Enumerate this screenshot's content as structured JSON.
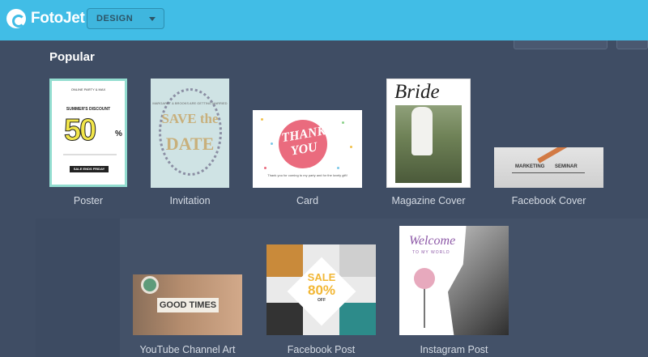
{
  "app": {
    "name": "FotoJet",
    "mode_select": "DESIGN"
  },
  "section": {
    "title": "Popular"
  },
  "templates": [
    {
      "label": "Poster"
    },
    {
      "label": "Invitation"
    },
    {
      "label": "Card"
    },
    {
      "label": "Magazine Cover"
    },
    {
      "label": "Facebook Cover"
    },
    {
      "label": "YouTube Channel Art"
    },
    {
      "label": "Facebook Post"
    },
    {
      "label": "Instagram Post"
    }
  ],
  "thumbs": {
    "poster": {
      "top": "ONLINE PARTY & MAX",
      "head": "SUMMER'S DISCOUNT",
      "big": "50",
      "pct": "%",
      "sale": "SALE ENDS FRIDAY"
    },
    "invitation": {
      "names": "MARGARET & BROOKS ARE GETTING MARRIED",
      "save": "SAVE the",
      "date": "DATE"
    },
    "card": {
      "thanks": "THANK YOU",
      "msg": "Thank you for coming to my party and for the lovely gift!"
    },
    "magazine": {
      "title": "Bride"
    },
    "fbcover": {
      "left": "MARKETING",
      "right": "SEMINAR"
    },
    "youtube": {
      "text": "GOOD TIMES"
    },
    "fbpost": {
      "sale": "SALE",
      "num": "80%",
      "off": "OFF"
    },
    "instagram": {
      "welcome": "Welcome",
      "sub": "TO MY WORLD"
    }
  },
  "colors": {
    "topbar": "#41bde6",
    "background": "#3f4d64",
    "label": "#d5dbe4"
  },
  "icons": {
    "logo": "fotojet-logo-icon",
    "select": "chevron-down-icon"
  }
}
